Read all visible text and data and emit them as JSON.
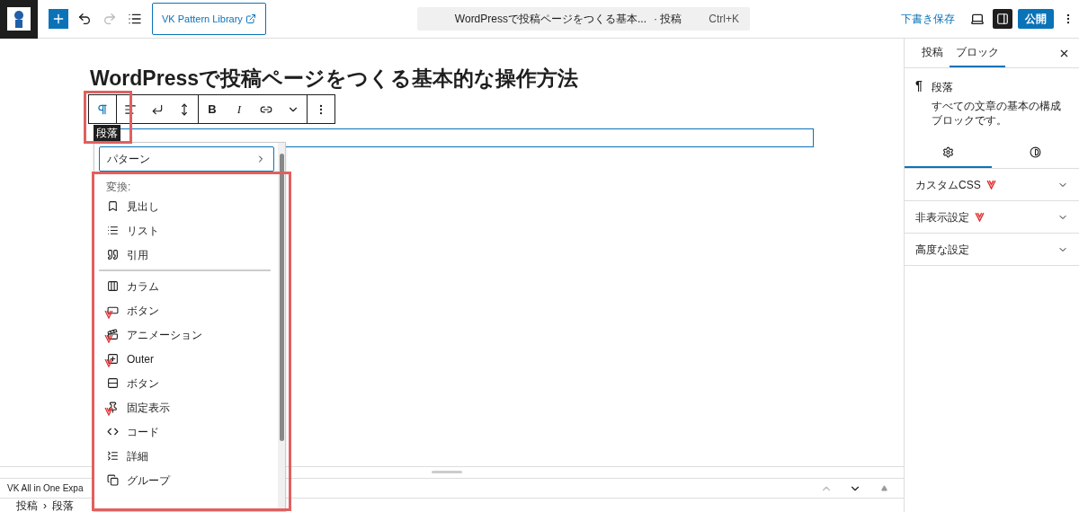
{
  "top_bar": {
    "pattern_library": "VK Pattern Library",
    "command": {
      "title": "WordPressで投稿ページをつくる基本...",
      "type": "· 投稿",
      "shortcut": "Ctrl+K"
    },
    "redo_disabled": true,
    "save_draft": "下書き保存",
    "sidebar_open": true,
    "publish": "公開"
  },
  "post_title": "WordPressで投稿ページをつくる基本的な操作方法",
  "block_toolbar": {
    "buttons": [
      {
        "kind": "paragraph",
        "selected": true
      },
      {
        "kind": "align",
        "selected": false
      },
      {
        "kind": "vk-return",
        "selected": false
      },
      {
        "kind": "vk-spacing",
        "selected": false
      },
      {
        "kind": "bold",
        "label": "B",
        "selected": false
      },
      {
        "kind": "italic",
        "label": "I",
        "selected": false
      },
      {
        "kind": "link",
        "selected": false
      },
      {
        "kind": "chevron",
        "selected": false
      },
      {
        "kind": "more",
        "selected": false
      }
    ],
    "tooltip": "段落"
  },
  "transform_menu": {
    "patterns": "パターン",
    "section_label": "変換:",
    "items": [
      {
        "label": "見出し",
        "kind": "heading",
        "badge": false,
        "divider_before": false
      },
      {
        "label": "リスト",
        "kind": "list",
        "badge": false,
        "divider_before": false
      },
      {
        "label": "引用",
        "kind": "quote",
        "badge": false,
        "divider_before": false
      },
      {
        "label": "カラム",
        "kind": "columns",
        "badge": false,
        "divider_before": true
      },
      {
        "label": "ボタン",
        "kind": "button",
        "badge": true,
        "divider_before": false
      },
      {
        "label": "アニメーション",
        "kind": "animation",
        "badge": true,
        "divider_before": false
      },
      {
        "label": "Outer",
        "kind": "outer",
        "badge": true,
        "divider_before": false
      },
      {
        "label": "ボタン",
        "kind": "buttons",
        "badge": false,
        "divider_before": false
      },
      {
        "label": "固定表示",
        "kind": "fixed",
        "badge": true,
        "divider_before": false
      },
      {
        "label": "コード",
        "kind": "code",
        "badge": false,
        "divider_before": false
      },
      {
        "label": "詳細",
        "kind": "details",
        "badge": false,
        "divider_before": false
      },
      {
        "label": "グループ",
        "kind": "group",
        "badge": false,
        "divider_before": false
      }
    ]
  },
  "meta_box": {
    "title": "VK All in One Expa",
    "move_up_disabled": true
  },
  "breadcrumb": [
    "投稿",
    "段落"
  ],
  "breadcrumb_separator": "›",
  "sidebar": {
    "tabs": [
      {
        "label": "投稿",
        "selected": false
      },
      {
        "label": "ブロック",
        "selected": true
      }
    ],
    "block": {
      "icon": "¶",
      "name": "段落",
      "description": "すべての文章の基本の構成ブロックです。"
    },
    "subtabs": [
      {
        "kind": "settings",
        "selected": true
      },
      {
        "kind": "styles",
        "selected": false
      }
    ],
    "panels": [
      {
        "title": "カスタムCSS",
        "badge": true
      },
      {
        "title": "非表示設定",
        "badge": true
      },
      {
        "title": "高度な設定",
        "badge": false
      }
    ]
  }
}
